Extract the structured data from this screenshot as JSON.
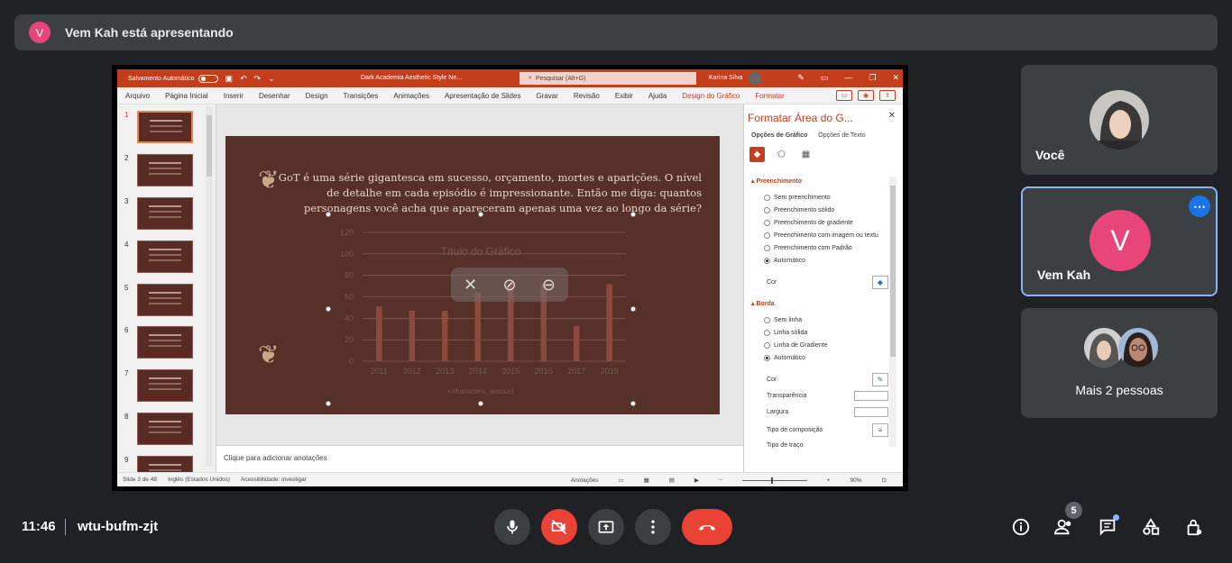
{
  "presenting": {
    "avatar_letter": "V",
    "text": "Vem Kah está apresentando"
  },
  "ppt": {
    "autosave_label": "Salvamento Automático",
    "doc_title": "Dark Academia Aesthetic Style Ne...",
    "search_placeholder": "Pesquisar (Alt+G)",
    "user_name": "Karina Silva",
    "menu": [
      "Arquivo",
      "Página Inicial",
      "Inserir",
      "Desenhar",
      "Design",
      "Transições",
      "Animações",
      "Apresentação de Slides",
      "Gravar",
      "Revisão",
      "Exibir",
      "Ajuda",
      "Design do Gráfico",
      "Formatar"
    ],
    "thumb_numbers": [
      "1",
      "2",
      "3",
      "4",
      "5",
      "6",
      "7",
      "8",
      "9"
    ],
    "slide_text": "GoT é uma série gigantesca em sucesso, orçamento, mortes e aparições. O nível de detalhe em cada episódio é impressionante. Então me diga: quantos personagens você acha que apareceram apenas uma vez ao longo da série?",
    "notes_placeholder": "Clique para adicionar anotações",
    "pane": {
      "title": "Formatar Área do G...",
      "tab_chart": "Opções de Gráfico",
      "tab_text": "Opções de Texto",
      "fill_section": "Preenchimento",
      "fill_options": [
        "Sem preenchimento",
        "Preenchimento sólido",
        "Preenchimento de gradiente",
        "Preenchimento com imagem ou textu",
        "Preenchimento com Padrão",
        "Automático"
      ],
      "color_label": "Cor",
      "border_section": "Borda",
      "border_options": [
        "Sem linha",
        "Linha sólida",
        "Linha de Gradiente",
        "Automático"
      ],
      "transparency_label": "Transparência",
      "width_label": "Largura",
      "compound_label": "Tipo de composição",
      "dash_label": "Tipo de traço"
    },
    "status": {
      "slide": "Slide 3 de 48",
      "language": "Inglês (Estados Unidos)",
      "accessibility": "Acessibilidade: investigar",
      "notes": "Anotações",
      "zoom": "90%"
    }
  },
  "chart_data": {
    "type": "bar",
    "title": "Título do Gráfico",
    "categories": [
      "2011",
      "2012",
      "2013",
      "2014",
      "2015",
      "2016",
      "2017",
      "2019"
    ],
    "series": [
      {
        "name": "characters_amount",
        "values": [
          51,
          47,
          47,
          64,
          73,
          72,
          33,
          72
        ]
      }
    ],
    "ylim": [
      0,
      120
    ],
    "yticks": [
      0,
      20,
      40,
      60,
      80,
      100,
      120
    ],
    "grid": true,
    "legend": "bottom",
    "bar_color": "#8a4a40"
  },
  "participants": {
    "you": {
      "name": "Você"
    },
    "presenter": {
      "name": "Vem Kah",
      "letter": "V"
    },
    "more": {
      "label": "Mais 2 pessoas"
    }
  },
  "bottom": {
    "time": "11:46",
    "meeting_code": "wtu-bufm-zjt",
    "people_count": "5"
  },
  "colors": {
    "accent_red": "#ea4335",
    "avatar_pink": "#e8457a",
    "highlight_blue": "#8ab4f8"
  }
}
